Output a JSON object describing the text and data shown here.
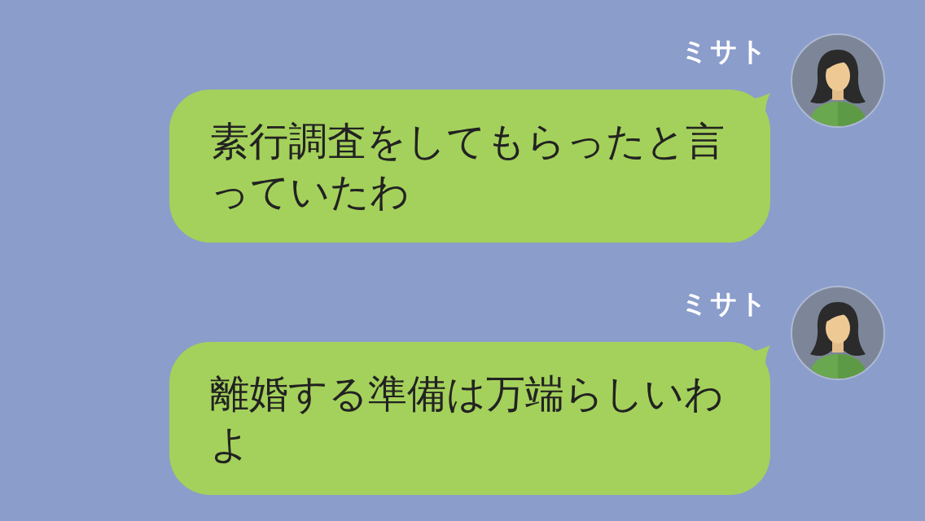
{
  "messages": [
    {
      "sender": "ミサト",
      "text": "素行調査をしてもらったと言っていたわ"
    },
    {
      "sender": "ミサト",
      "text": "離婚する準備は万端らしいわよ"
    }
  ]
}
